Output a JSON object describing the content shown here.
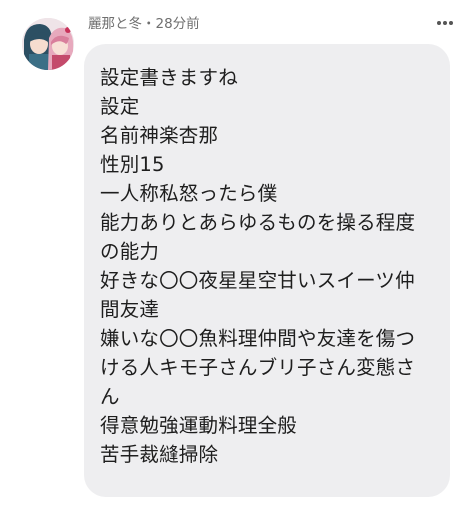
{
  "post": {
    "author": "麗那と冬",
    "separator": "・",
    "time": "28分前",
    "more_icon": "more-horizontal-icon"
  },
  "message": {
    "lines": [
      "設定書きますね",
      "設定",
      "名前神楽杏那",
      "性別15",
      "一人称私怒ったら僕",
      "能力ありとあらゆるものを操る程度",
      "の能力",
      "好きな〇〇夜星星空甘いスイーツ仲",
      "間友達",
      "嫌いな〇〇魚料理仲間や友達を傷つ",
      "ける人キモ子さんブリ子さん変態さ",
      "ん",
      "得意勉強運動料理全般",
      "苦手裁縫掃除"
    ]
  },
  "colors": {
    "bubble": "#eeeef0",
    "text": "#1e1e1e",
    "meta": "#6f6f6f"
  }
}
